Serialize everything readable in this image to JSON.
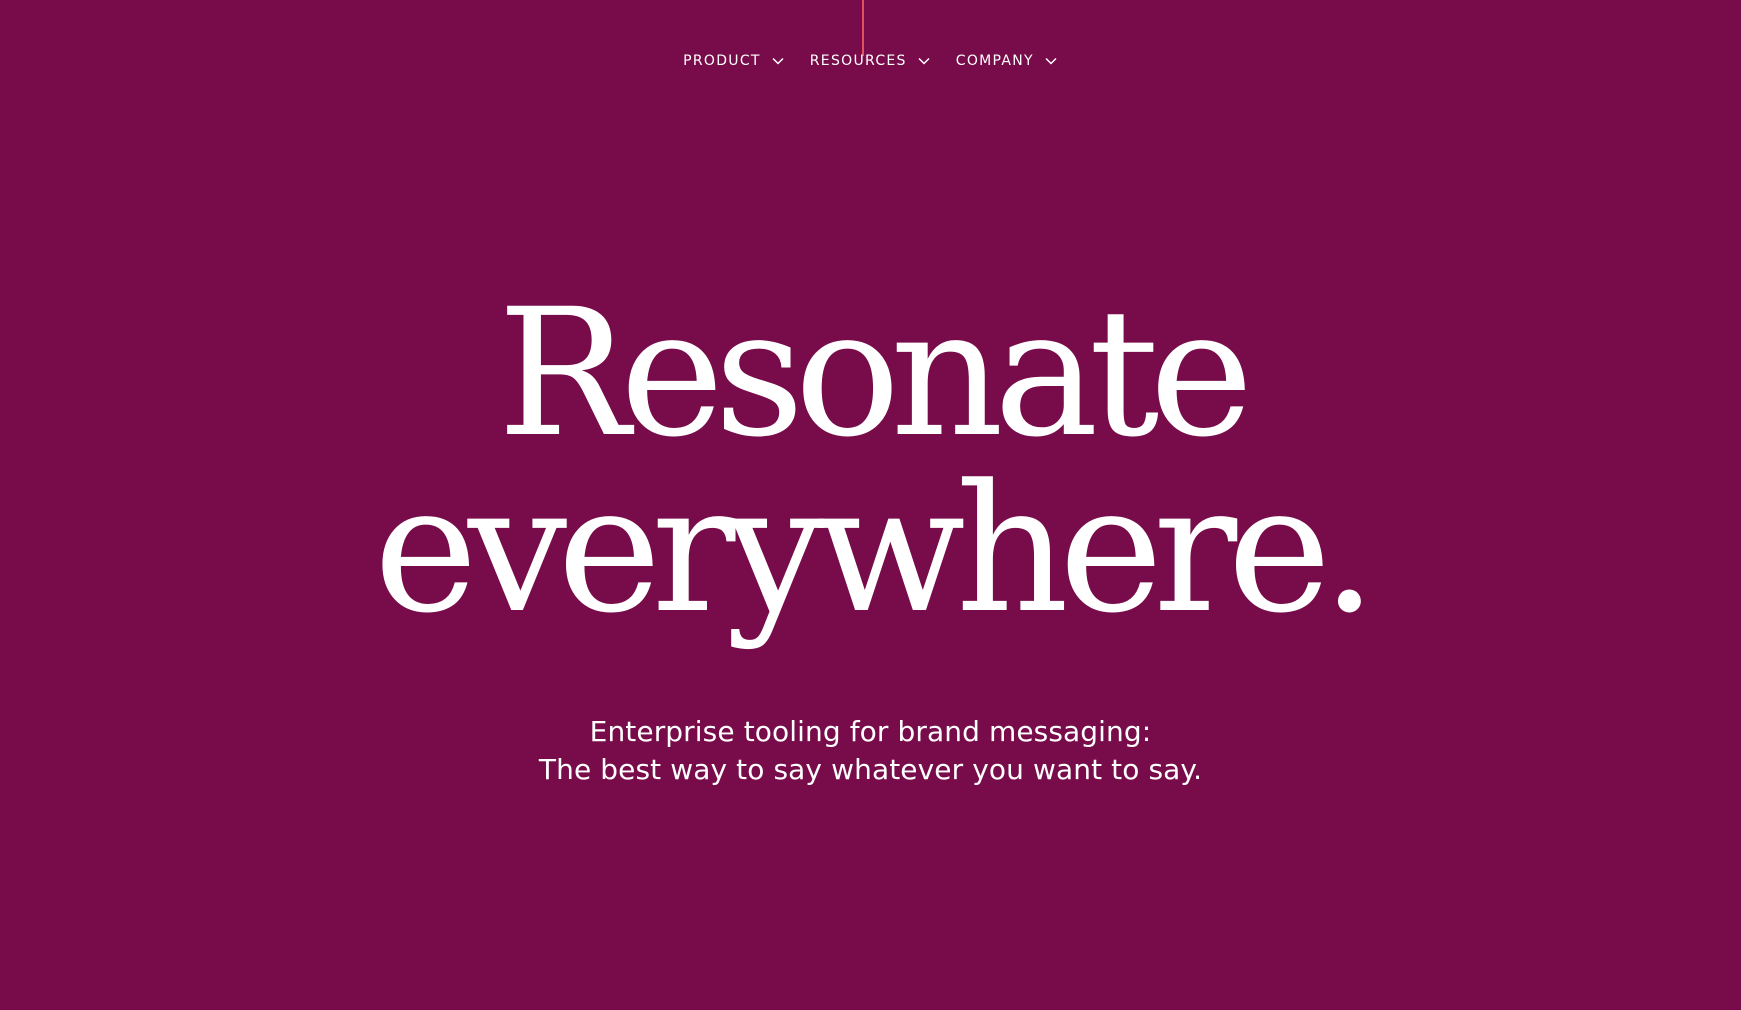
{
  "nav": {
    "items": [
      {
        "label": "PRODUCT",
        "icon": "chevron-down-icon"
      },
      {
        "label": "RESOURCES",
        "icon": "chevron-down-icon"
      },
      {
        "label": "COMPANY",
        "icon": "chevron-down-icon"
      }
    ]
  },
  "hero": {
    "line1": "Resonate",
    "line2": "everywhere."
  },
  "subtitle": {
    "line1": "Enterprise tooling for brand messaging:",
    "line2": "The best way to say whatever you want to say."
  },
  "colors": {
    "background": "#780c4a",
    "text": "#ffffff",
    "accent_line": "#e0525f"
  }
}
